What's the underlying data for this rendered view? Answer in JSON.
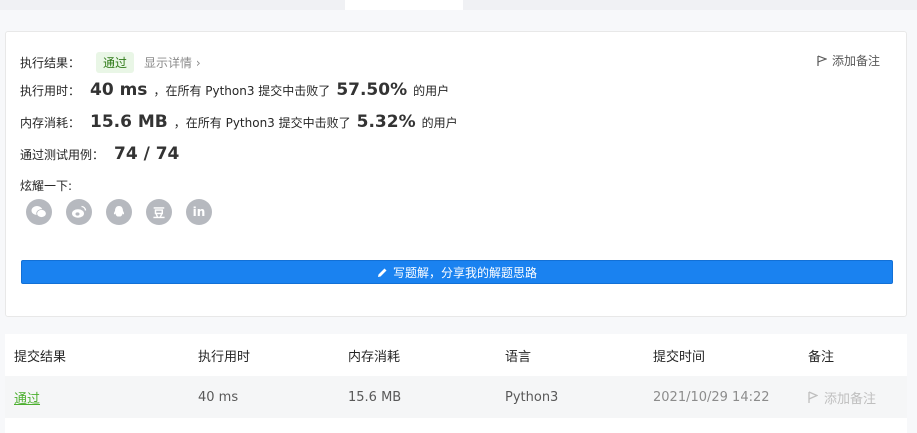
{
  "result": {
    "label": "执行结果：",
    "status": "通过",
    "detail_link": "显示详情 ›",
    "note_button": "添加备注"
  },
  "runtime": {
    "label": "执行用时：",
    "value": "40 ms",
    "mid": "，在所有 Python3 提交中击败了",
    "percent": "57.50%",
    "suffix": "的用户"
  },
  "memory": {
    "label": "内存消耗：",
    "value": "15.6 MB",
    "mid": "，在所有 Python3 提交中击败了",
    "percent": "5.32%",
    "suffix": "的用户"
  },
  "tests": {
    "label": "通过测试用例：",
    "value": "74 / 74"
  },
  "share": {
    "label": "炫耀一下:",
    "icons": [
      "wechat-icon",
      "weibo-icon",
      "qq-icon",
      "douban-icon",
      "linkedin-icon"
    ],
    "douban_glyph": "豆",
    "linkedin_glyph": "in"
  },
  "write_solution": "写题解，分享我的解题思路",
  "table": {
    "headers": [
      "提交结果",
      "执行用时",
      "内存消耗",
      "语言",
      "提交时间",
      "备注"
    ],
    "rows": [
      {
        "status": "通过",
        "runtime": "40 ms",
        "memory": "15.6 MB",
        "language": "Python3",
        "time": "2021/10/29 14:22",
        "note": "添加备注"
      }
    ]
  },
  "colors": {
    "accent": "#1a82f0",
    "success": "#4caf2f",
    "badge_bg": "#e9f6e6"
  }
}
